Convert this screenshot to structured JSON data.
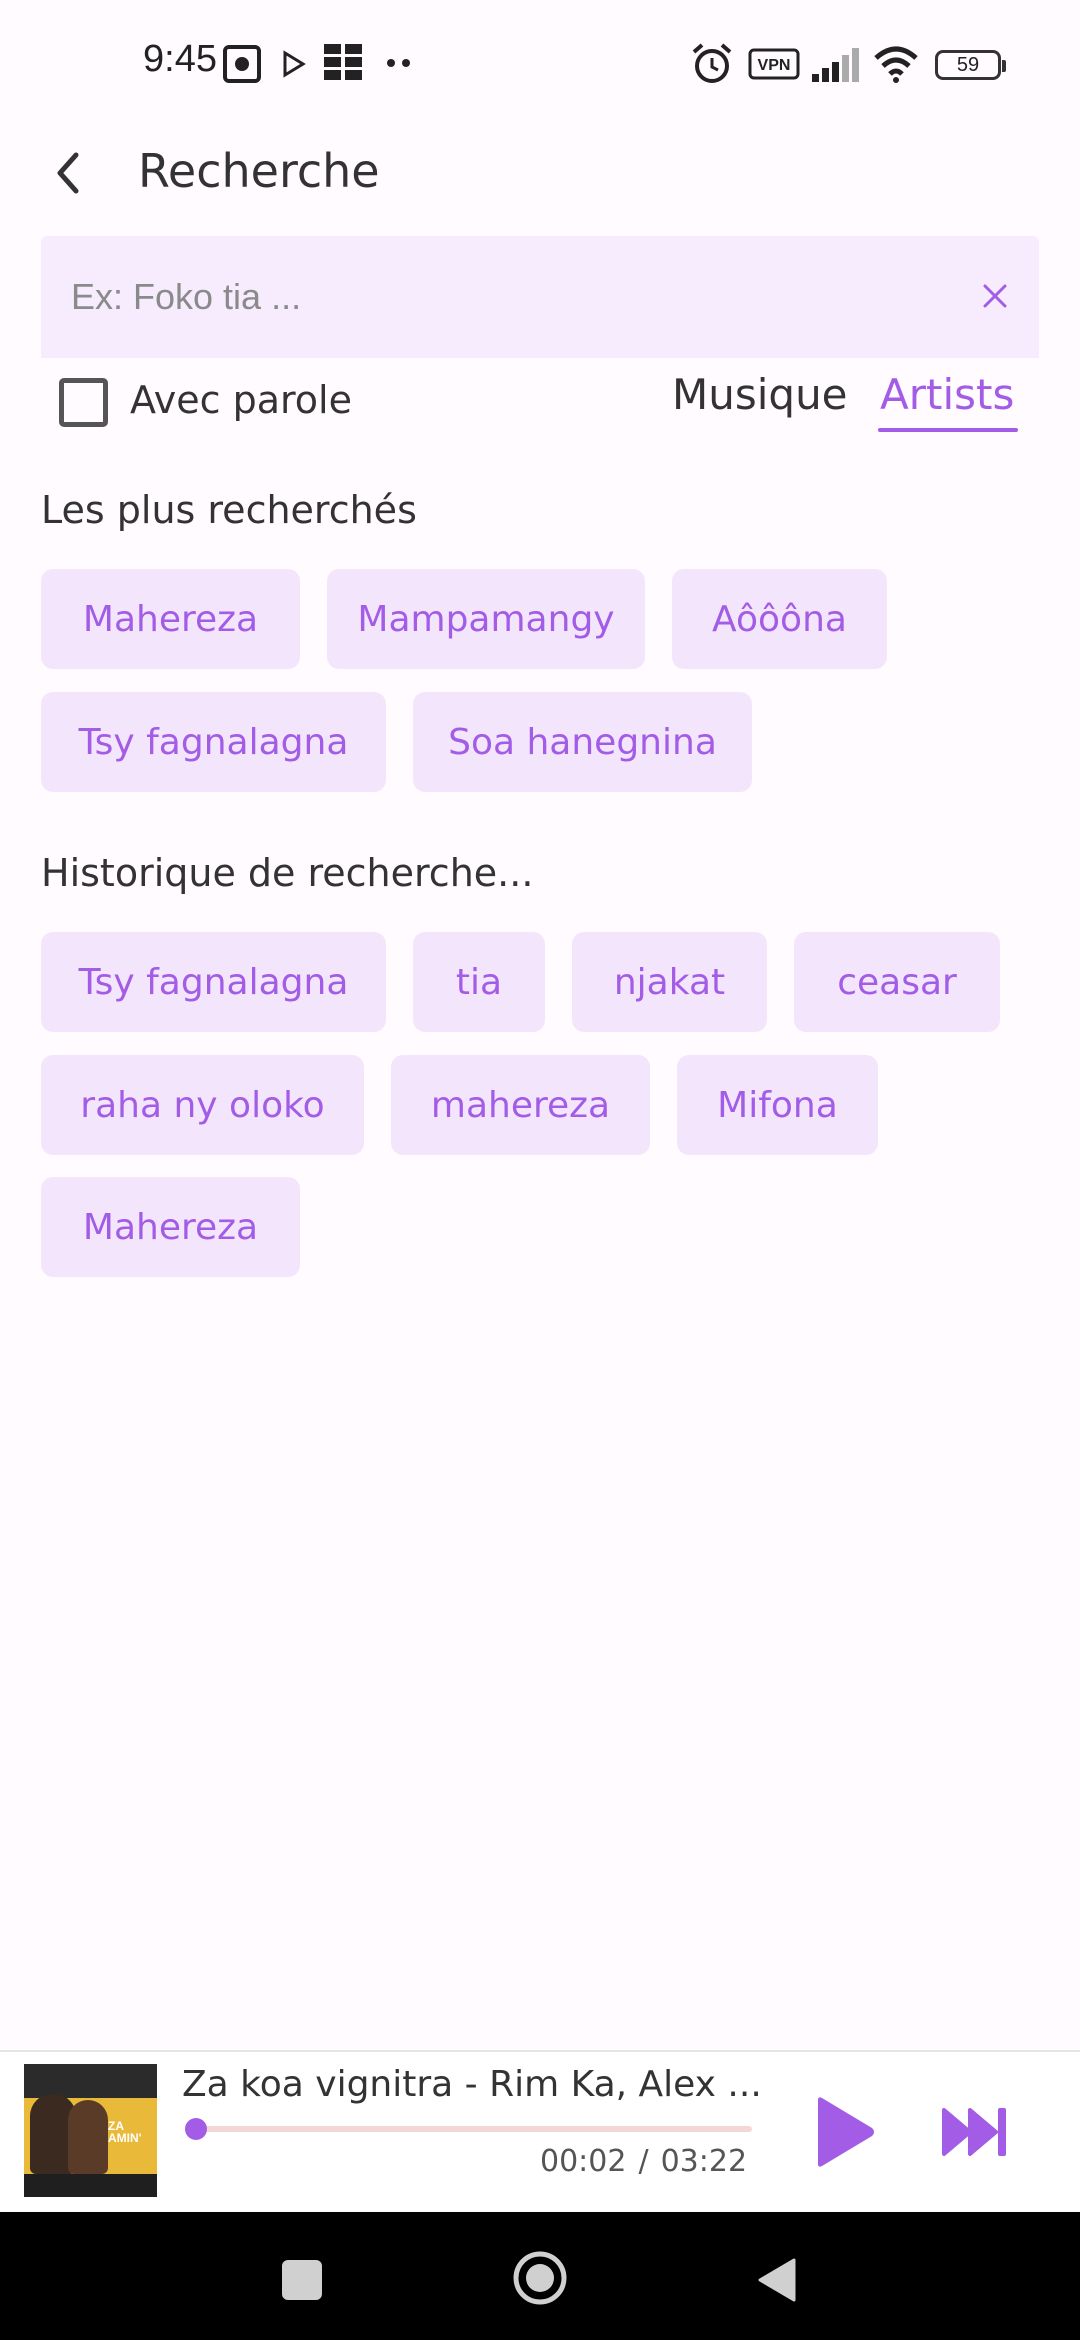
{
  "status_bar": {
    "time": "9:45",
    "battery": "59",
    "vpn_label": "VPN",
    "icons": [
      "screen-record-icon",
      "play-store-icon",
      "apps-grid-icon",
      "more-dots-icon",
      "alarm-icon",
      "vpn-icon",
      "signal-icon",
      "wifi-icon",
      "battery-icon"
    ]
  },
  "app_bar": {
    "title": "Recherche",
    "back_icon": "back-arrow-icon"
  },
  "search": {
    "placeholder": "Ex: Foko tia ...",
    "value": "",
    "clear_icon": "close-icon"
  },
  "options": {
    "lyrics_checkbox_label": "Avec parole",
    "lyrics_checked": false,
    "tabs": [
      {
        "label": "Musique",
        "active": false
      },
      {
        "label": "Artists",
        "active": true
      }
    ]
  },
  "popular": {
    "title": "Les plus recherchés",
    "chips": [
      "Mahereza",
      "Mampamangy",
      "Aôôôna",
      "Tsy fagnalagna",
      "Soa hanegnina"
    ]
  },
  "history": {
    "title": "Historique de recherche...",
    "chips": [
      "Tsy fagnalagna",
      "tia",
      "njakat",
      "ceasar",
      "raha ny oloko",
      "mahereza",
      "Mifona",
      "Mahereza"
    ]
  },
  "player": {
    "track_title": "Za koa vignitra - Rim Ka, Alex ...",
    "elapsed": "00:02",
    "separator": "/",
    "duration": "03:22",
    "progress_fraction": 0.01,
    "album_art_text": "ZA AMIN'"
  },
  "colors": {
    "accent": "#A35CE6",
    "chip_bg": "#F3E6FC",
    "search_bg": "#F6ECFD",
    "background": "#FFFBFE"
  }
}
